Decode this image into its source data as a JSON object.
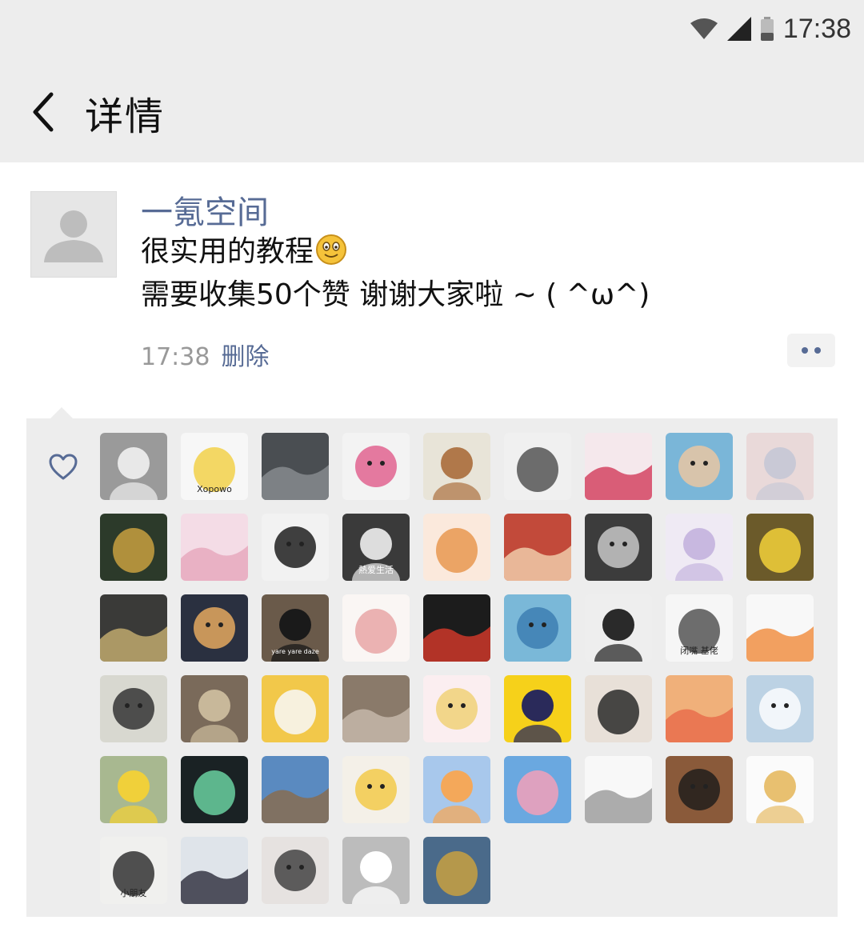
{
  "status_bar": {
    "time": "17:38",
    "icons": [
      "wifi-icon",
      "cell-signal-icon",
      "battery-icon"
    ]
  },
  "nav": {
    "back_icon": "chevron-left-icon",
    "title": "详情"
  },
  "post": {
    "author": "一氪空间",
    "avatar_icon": "default-avatar-icon",
    "line1": "很实用的教程",
    "line1_emoji": "smile-emoji",
    "line2": "需要收集50个赞 谢谢大家啦 ~ (    ^ω^)",
    "time": "17:38",
    "delete_label": "删除",
    "more_icon": "more-dots-icon"
  },
  "likes": {
    "heart_icon": "heart-icon",
    "avatars": [
      {
        "label": "",
        "bg": "#9a9a9a",
        "fg": "#e8e8e8"
      },
      {
        "label": "Xopowo",
        "bg": "#f7f7f7",
        "fg": "#f2d14a"
      },
      {
        "label": "",
        "bg": "#4a4e52",
        "fg": "#8a8e92"
      },
      {
        "label": "",
        "bg": "#f3f3f3",
        "fg": "#e05a8a"
      },
      {
        "label": "",
        "bg": "#e8e4d8",
        "fg": "#b0784a"
      },
      {
        "label": "",
        "bg": "#f0f0f0",
        "fg": "#555555"
      },
      {
        "label": "",
        "bg": "#f5e8ec",
        "fg": "#d23a5a"
      },
      {
        "label": "",
        "bg": "#7ab6d8",
        "fg": "#f0c8a0"
      },
      {
        "label": "",
        "bg": "#e9d9d9",
        "fg": "#c9c9d6"
      },
      {
        "label": "",
        "bg": "#2c3a2a",
        "fg": "#c8a040"
      },
      {
        "label": "",
        "bg": "#f4dce6",
        "fg": "#e6a6bc"
      },
      {
        "label": "",
        "bg": "#f2f2f2",
        "fg": "#111111"
      },
      {
        "label": "熱爱生活",
        "bg": "#3a3a3a",
        "fg": "#dddddd"
      },
      {
        "label": "",
        "bg": "#fbe9dc",
        "fg": "#e89850"
      },
      {
        "label": "",
        "bg": "#c24a3a",
        "fg": "#f3d2b0"
      },
      {
        "label": "",
        "bg": "#3c3c3c",
        "fg": "#cfcfcf"
      },
      {
        "label": "",
        "bg": "#efeaf4",
        "fg": "#c8b8e0"
      },
      {
        "label": "",
        "bg": "#6b5a2a",
        "fg": "#f2d13a"
      },
      {
        "label": "",
        "bg": "#3a3a38",
        "fg": "#c8b070"
      },
      {
        "label": "",
        "bg": "#2a3040",
        "fg": "#f0b060"
      },
      {
        "label": "yare yare daze",
        "bg": "#6a5a4a",
        "fg": "#1a1a1a"
      },
      {
        "label": "",
        "bg": "#faf6f4",
        "fg": "#e8a6a6"
      },
      {
        "label": "",
        "bg": "#1c1c1c",
        "fg": "#d83a2a"
      },
      {
        "label": "",
        "bg": "#7ab8d8",
        "fg": "#3a7ab0"
      },
      {
        "label": "",
        "bg": "#eeeeee",
        "fg": "#2a2a2a"
      },
      {
        "label": "闭嘴 基佬",
        "bg": "#f6f6f6",
        "fg": "#555555"
      },
      {
        "label": "",
        "bg": "#f8f8f8",
        "fg": "#f08a3a"
      },
      {
        "label": "",
        "bg": "#d8d8d0",
        "fg": "#2a2a2a"
      },
      {
        "label": "",
        "bg": "#7a6a5a",
        "fg": "#c8b89a"
      },
      {
        "label": "",
        "bg": "#f2c84a",
        "fg": "#f8f8f8"
      },
      {
        "label": "",
        "bg": "#8a7a6a",
        "fg": "#c8bcae"
      },
      {
        "label": "",
        "bg": "#fbeef0",
        "fg": "#f0d070"
      },
      {
        "label": "",
        "bg": "#f6d11a",
        "fg": "#2a2a5a"
      },
      {
        "label": "",
        "bg": "#e8e0d8",
        "fg": "#2a2a2a"
      },
      {
        "label": "",
        "bg": "#f0b07a",
        "fg": "#e86a4a"
      },
      {
        "label": "",
        "bg": "#bcd2e4",
        "fg": "#ffffff"
      },
      {
        "label": "",
        "bg": "#a8b890",
        "fg": "#f0d03a"
      },
      {
        "label": "",
        "bg": "#1a2224",
        "fg": "#6ad0a0"
      },
      {
        "label": "",
        "bg": "#5a8ac0",
        "fg": "#8a6a4a"
      },
      {
        "label": "",
        "bg": "#f4f0e8",
        "fg": "#f2c840"
      },
      {
        "label": "",
        "bg": "#a8c8ec",
        "fg": "#f4a85a"
      },
      {
        "label": "",
        "bg": "#6aa8e0",
        "fg": "#f2a0b8"
      },
      {
        "label": "",
        "bg": "#f8f8f8",
        "fg": "#999999"
      },
      {
        "label": "",
        "bg": "#8a5a3a",
        "fg": "#1a1a1a"
      },
      {
        "label": "",
        "bg": "#fbfbfb",
        "fg": "#e8c070"
      },
      {
        "label": "小朋友",
        "bg": "#f0f0ee",
        "fg": "#333333"
      },
      {
        "label": "",
        "bg": "#dfe4ea",
        "fg": "#2a2a3a"
      },
      {
        "label": "",
        "bg": "#e6e2e0",
        "fg": "#3a3a3a"
      },
      {
        "label": "",
        "bg": "#bcbcbc",
        "fg": "#ffffff"
      },
      {
        "label": "",
        "bg": "#4a6a8a",
        "fg": "#c8a040"
      }
    ]
  }
}
